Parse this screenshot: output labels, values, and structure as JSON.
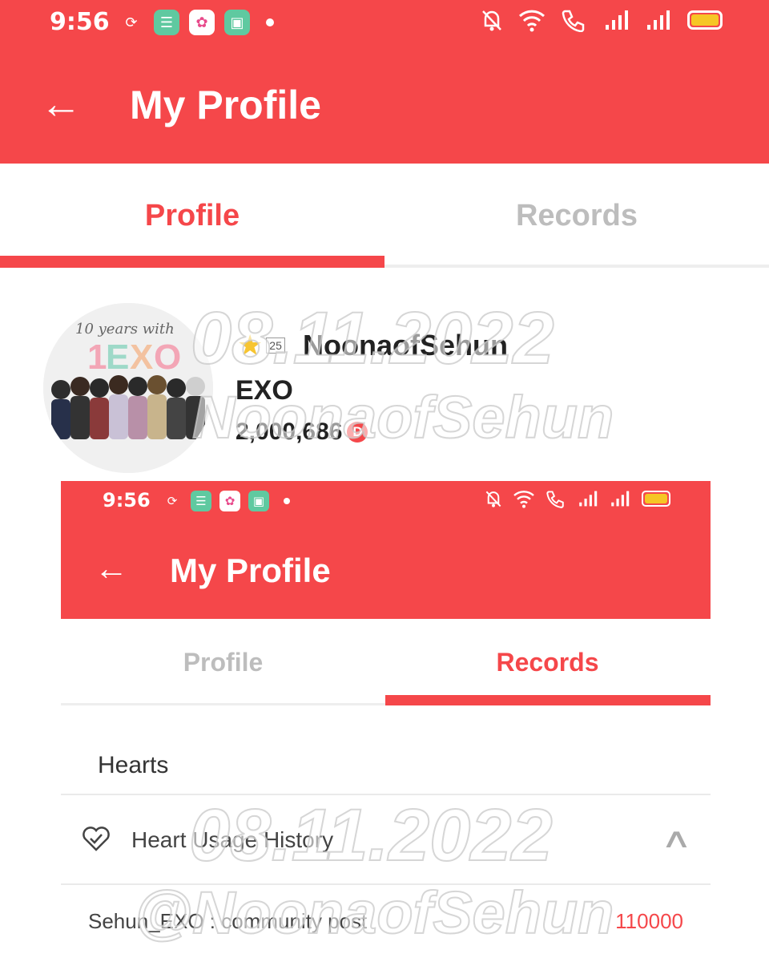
{
  "status_bar": {
    "time": "9:56",
    "app_icons": [
      "sync-icon",
      "app-green-icon",
      "photos-icon",
      "gallery-icon"
    ],
    "system_icons": [
      "mute-bell-icon",
      "wifi-icon",
      "wifi-call-icon",
      "signal-1-icon",
      "signal-2-icon",
      "battery-icon"
    ],
    "battery_color": "#f6c625"
  },
  "app_bar": {
    "back_icon": "back-arrow-icon",
    "title": "My Profile"
  },
  "tabs": {
    "profile": "Profile",
    "records": "Records",
    "active": "Profile"
  },
  "profile": {
    "avatar_icon": "exo-10-years-avatar",
    "level": "25",
    "username": "NoonaofSehun",
    "fandom": "EXO",
    "points": "2,000,686",
    "points_icon": "d-coin-icon"
  },
  "embedded_screenshot": {
    "status_bar": {
      "time": "9:56"
    },
    "app_bar": {
      "title": "My Profile"
    },
    "tabs": {
      "profile": "Profile",
      "records": "Records",
      "active": "Records"
    },
    "section_title": "Hearts",
    "history": {
      "icon": "heart-history-icon",
      "label": "Heart Usage History",
      "expanded_icon": "chevron-up-icon"
    },
    "records": [
      {
        "label": "Sehun_EXO : community post",
        "value": "110000"
      }
    ]
  },
  "watermarks": {
    "date": "08.11.2022",
    "handle_top": "NoonaofSehun",
    "handle_bottom": "@NoonaofSehun"
  },
  "colors": {
    "accent": "#f5474a",
    "inactive_tab": "#bdbdbd"
  }
}
